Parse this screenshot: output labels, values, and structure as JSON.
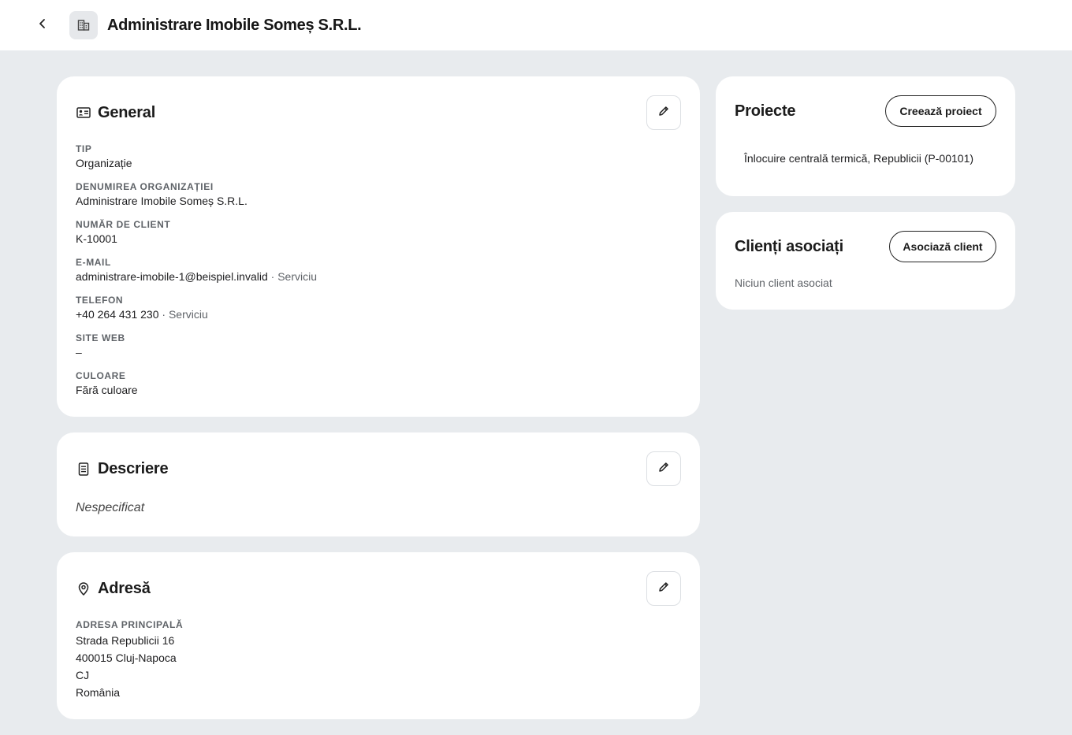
{
  "header": {
    "title": "Administrare Imobile Someș S.R.L.",
    "back_icon": "chevron-left-icon",
    "entity_icon": "building-icon"
  },
  "general": {
    "title": "General",
    "icon": "id-card-icon",
    "fields": {
      "type": {
        "label": "TIP",
        "value": "Organizație"
      },
      "org_name": {
        "label": "DENUMIREA ORGANIZAȚIEI",
        "value": "Administrare Imobile Someș S.R.L."
      },
      "client_number": {
        "label": "NUMĂR DE CLIENT",
        "value": "K-10001"
      },
      "email": {
        "label": "E-MAIL",
        "value": "administrare-imobile-1@beispiel.invalid",
        "suffix": " · Serviciu"
      },
      "phone": {
        "label": "TELEFON",
        "value": "+40 264 431 230",
        "suffix": " · Serviciu"
      },
      "website": {
        "label": "SITE WEB",
        "value": "–"
      },
      "color": {
        "label": "CULOARE",
        "value": "Fără culoare"
      }
    }
  },
  "description": {
    "title": "Descriere",
    "icon": "document-icon",
    "value": "Nespecificat"
  },
  "address": {
    "title": "Adresă",
    "icon": "location-pin-icon",
    "label": "ADRESA PRINCIPALĂ",
    "lines": [
      "Strada Republicii 16",
      "400015 Cluj-Napoca",
      "CJ",
      "România"
    ]
  },
  "projects": {
    "title": "Proiecte",
    "button_label": "Creează proiect",
    "items": [
      "Înlocuire centrală termică, Republicii (P-00101)"
    ]
  },
  "related_clients": {
    "title": "Clienți asociați",
    "button_label": "Asociază client",
    "empty_text": "Niciun client asociat"
  }
}
